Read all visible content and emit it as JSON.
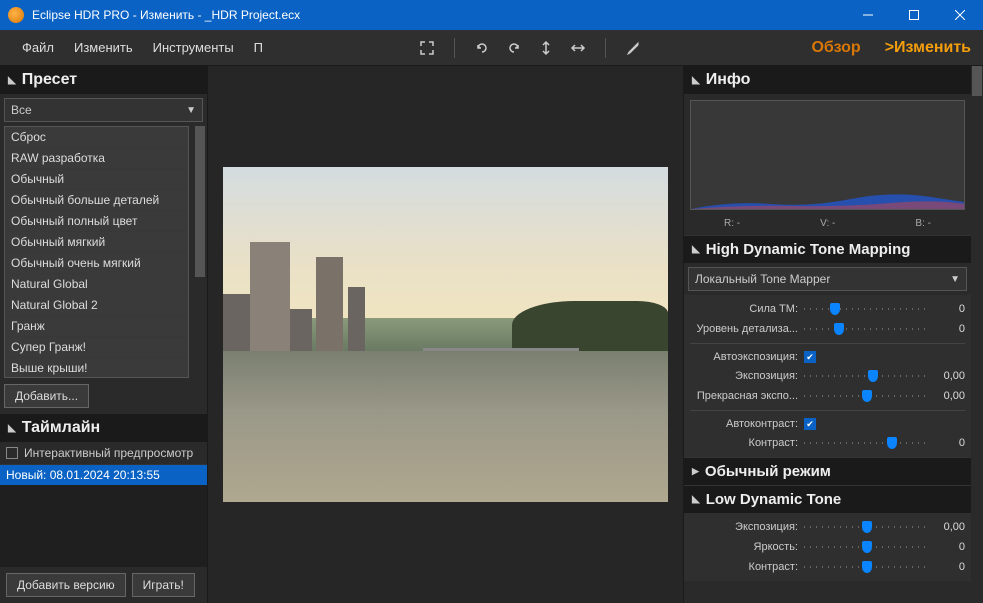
{
  "window": {
    "title": "Eclipse HDR PRO - Изменить - _HDR Project.ecx"
  },
  "menu": {
    "file": "Файл",
    "edit": "Изменить",
    "tools": "Инструменты",
    "p": "П"
  },
  "tabs": {
    "overview": "Обзор",
    "edit": ">Изменить"
  },
  "preset": {
    "title": "Пресет",
    "filter": "Все",
    "items": [
      "Сброс",
      "RAW разработка",
      "Обычный",
      "Обычный больше деталей",
      "Обычный полный цвет",
      "Обычный мягкий",
      "Обычный очень мягкий",
      "Natural Global",
      "Natural Global 2",
      "Гранж",
      "Супер Гранж!",
      "Выше крыши!"
    ],
    "add_btn": "Добавить..."
  },
  "timeline": {
    "title": "Таймлайн",
    "checkbox_label": "Интерактивный предпросмотр",
    "entry": "Новый: 08.01.2024 20:13:55",
    "add_version": "Добавить версию",
    "play": "Играть!"
  },
  "info": {
    "title": "Инфо",
    "r_label": "R:  -",
    "v_label": "V:  -",
    "b_label": "B:  -"
  },
  "hdtm": {
    "title": "High Dynamic Tone Mapping",
    "mapper": "Локальный Tone Mapper",
    "tm_strength": {
      "label": "Сила ТМ:",
      "value": "0",
      "pos": 25
    },
    "detail": {
      "label": "Уровень детализа...",
      "value": "0",
      "pos": 28
    },
    "autoexp": {
      "label": "Автоэкспозиция:",
      "checked": true
    },
    "exposure": {
      "label": "Экспозиция:",
      "value": "0,00",
      "pos": 55
    },
    "fine_exp": {
      "label": "Прекрасная экспо...",
      "value": "0,00",
      "pos": 50
    },
    "autocontrast": {
      "label": "Автоконтраст:",
      "checked": true
    },
    "contrast": {
      "label": "Контраст:",
      "value": "0",
      "pos": 70
    }
  },
  "normal_mode": {
    "title": "Обычный режим"
  },
  "ldt": {
    "title": "Low Dynamic Tone",
    "exposure": {
      "label": "Экспозиция:",
      "value": "0,00",
      "pos": 50
    },
    "brightness": {
      "label": "Яркость:",
      "value": "0",
      "pos": 50
    },
    "contrast": {
      "label": "Контраст:",
      "value": "0",
      "pos": 50
    }
  }
}
